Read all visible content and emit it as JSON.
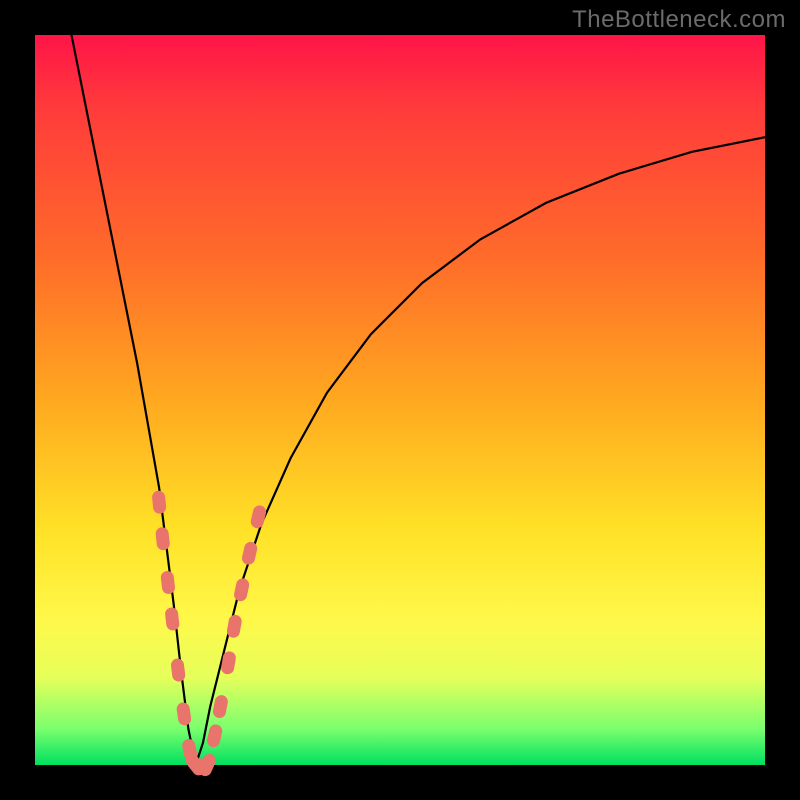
{
  "watermark": "TheBottleneck.com",
  "colors": {
    "frame": "#000000",
    "gradient_top": "#ff1448",
    "gradient_mid": "#ffe227",
    "gradient_bottom": "#00e060",
    "curve": "#000000",
    "marker": "#e8746b"
  },
  "chart_data": {
    "type": "line",
    "title": "",
    "xlabel": "",
    "ylabel": "",
    "xlim": [
      0,
      100
    ],
    "ylim": [
      0,
      100
    ],
    "grid": false,
    "note": "V-shaped bottleneck curve; y ≈ bottleneck %, x ≈ relative performance. Minimum near x≈22 where y≈0. Axis values estimated from geometry (no tick labels in source).",
    "series": [
      {
        "name": "bottleneck-curve",
        "x": [
          5,
          8,
          11,
          14,
          17,
          19,
          20,
          21,
          22,
          23,
          24,
          26,
          28,
          31,
          35,
          40,
          46,
          53,
          61,
          70,
          80,
          90,
          100
        ],
        "y": [
          100,
          85,
          70,
          55,
          38,
          22,
          13,
          5,
          0,
          3,
          8,
          16,
          24,
          33,
          42,
          51,
          59,
          66,
          72,
          77,
          81,
          84,
          86
        ]
      }
    ],
    "markers": {
      "name": "highlighted-points",
      "note": "Salmon capsule-shaped markers clustered near the curve minimum on both branches.",
      "points": [
        {
          "x": 17.0,
          "y": 36
        },
        {
          "x": 17.5,
          "y": 31
        },
        {
          "x": 18.2,
          "y": 25
        },
        {
          "x": 18.8,
          "y": 20
        },
        {
          "x": 19.6,
          "y": 13
        },
        {
          "x": 20.4,
          "y": 7
        },
        {
          "x": 21.2,
          "y": 2
        },
        {
          "x": 22.0,
          "y": 0
        },
        {
          "x": 22.8,
          "y": 0
        },
        {
          "x": 23.6,
          "y": 0
        },
        {
          "x": 24.6,
          "y": 4
        },
        {
          "x": 25.4,
          "y": 8
        },
        {
          "x": 26.5,
          "y": 14
        },
        {
          "x": 27.3,
          "y": 19
        },
        {
          "x": 28.3,
          "y": 24
        },
        {
          "x": 29.4,
          "y": 29
        },
        {
          "x": 30.6,
          "y": 34
        }
      ]
    }
  }
}
